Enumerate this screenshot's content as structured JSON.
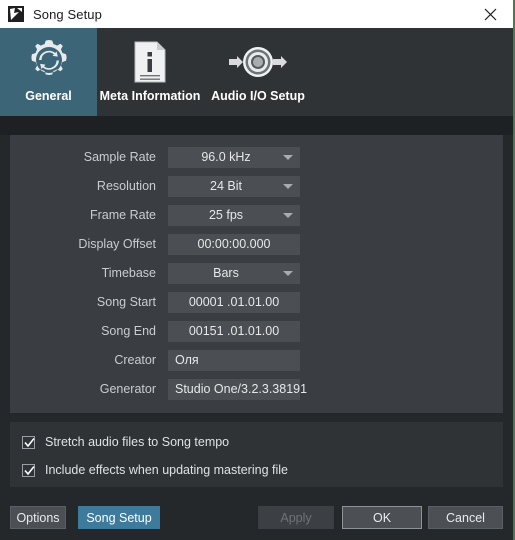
{
  "window": {
    "title": "Song Setup",
    "app_icon": "studio-one-logo-icon",
    "close_icon": "close-icon"
  },
  "tabs": [
    {
      "label": "General",
      "icon": "gear-refresh-icon",
      "active": true
    },
    {
      "label": "Meta Information",
      "icon": "document-info-icon",
      "active": false
    },
    {
      "label": "Audio I/O Setup",
      "icon": "audio-io-jack-icon",
      "active": false
    }
  ],
  "form": {
    "rows": [
      {
        "label": "Sample Rate",
        "value": "96.0 kHz",
        "type": "dropdown",
        "name": "sample-rate"
      },
      {
        "label": "Resolution",
        "value": "24 Bit",
        "type": "dropdown",
        "name": "resolution"
      },
      {
        "label": "Frame Rate",
        "value": "25 fps",
        "type": "dropdown",
        "name": "frame-rate"
      },
      {
        "label": "Display Offset",
        "value": "00:00:00.000",
        "type": "text-center",
        "name": "display-offset"
      },
      {
        "label": "Timebase",
        "value": "Bars",
        "type": "dropdown",
        "name": "timebase"
      },
      {
        "label": "Song Start",
        "value": "00001 .01.01.00",
        "type": "text-center",
        "name": "song-start"
      },
      {
        "label": "Song End",
        "value": "00151 .01.01.00",
        "type": "text-center",
        "name": "song-end"
      },
      {
        "label": "Creator",
        "value": "Оля",
        "type": "text-left",
        "name": "creator"
      },
      {
        "label": "Generator",
        "value": "Studio One/3.2.3.38191",
        "type": "text-left",
        "name": "generator"
      }
    ]
  },
  "checkboxes": [
    {
      "label": "Stretch audio files to Song tempo",
      "checked": true,
      "name": "stretch-audio-files"
    },
    {
      "label": "Include effects when updating mastering file",
      "checked": true,
      "name": "include-effects"
    }
  ],
  "buttons": {
    "options": "Options",
    "song_setup": "Song Setup",
    "apply": "Apply",
    "ok": "OK",
    "cancel": "Cancel"
  },
  "colors": {
    "accent": "#3d7a9c",
    "tab_active": "#3d6578",
    "panel": "#3a3e42",
    "field": "#4b4f53",
    "window_bg": "#25282b",
    "titlebar": "#ffffff"
  }
}
